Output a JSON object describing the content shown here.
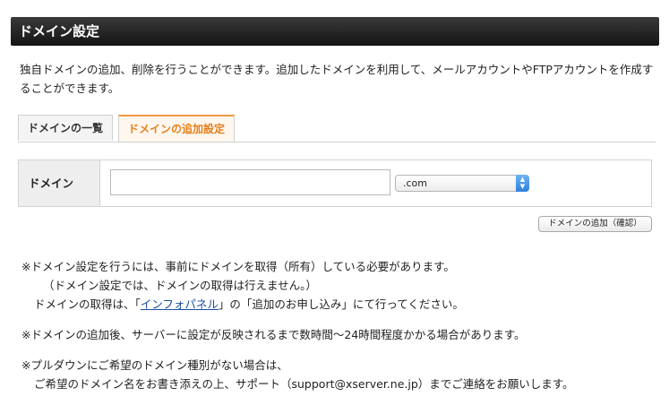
{
  "header": {
    "title": "ドメイン設定"
  },
  "description": "独自ドメインの追加、削除を行うことができます。追加したドメインを利用して、メールアカウントやFTPアカウントを作成することができます。",
  "tabs": [
    {
      "label": "ドメインの一覧",
      "active": false
    },
    {
      "label": "ドメインの追加設定",
      "active": true
    }
  ],
  "form": {
    "domain_label": "ドメイン",
    "domain_value": "",
    "domain_placeholder": "",
    "tld_selected": ".com",
    "submit_label": "ドメインの追加（確認）"
  },
  "notes": {
    "note1_line1": "※ドメイン設定を行うには、事前にドメインを取得（所有）している必要があります。",
    "note1_line2": "（ドメイン設定では、ドメインの取得は行えません。）",
    "note1_line3_pre": "ドメインの取得は、「",
    "note1_link": "インフォパネル",
    "note1_line3_post": "」の「追加のお申し込み」にて行ってください。",
    "note2": "※ドメインの追加後、サーバーに設定が反映されるまで数時間〜24時間程度かかる場合があります。",
    "note3_line1": "※プルダウンにご希望のドメイン種別がない場合は、",
    "note3_line2": "ご希望のドメイン名をお書き添えの上、サポート（support@xserver.ne.jp）までご連絡をお願いします。"
  },
  "colors": {
    "accent": "#e87f1c",
    "header_bg": "#1f1f1f",
    "link": "#1a4fa0"
  }
}
